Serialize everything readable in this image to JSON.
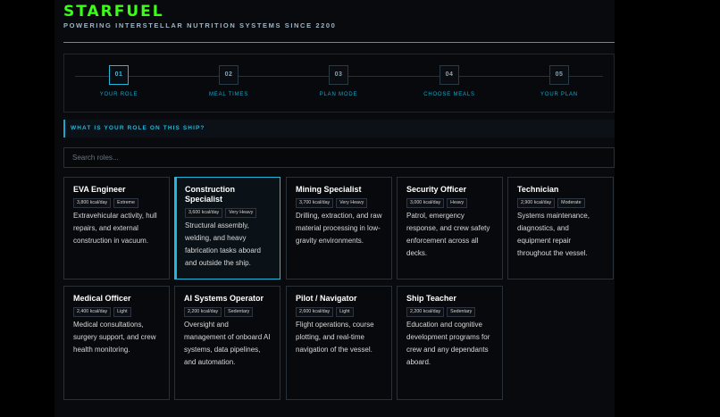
{
  "header": {
    "brand": "STARFUEL",
    "tagline": "POWERING INTERSTELLAR NUTRITION SYSTEMS SINCE 2200"
  },
  "steps": [
    {
      "num": "01",
      "label": "YOUR ROLE",
      "active": true
    },
    {
      "num": "02",
      "label": "MEAL TIMES",
      "active": false
    },
    {
      "num": "03",
      "label": "PLAN MODE",
      "active": false
    },
    {
      "num": "04",
      "label": "CHOOSE MEALS",
      "active": false
    },
    {
      "num": "05",
      "label": "YOUR PLAN",
      "active": false
    }
  ],
  "question": "WHAT IS YOUR ROLE ON THIS SHIP?",
  "search": {
    "placeholder": "Search roles...",
    "value": ""
  },
  "roles": [
    {
      "title": "EVA Engineer",
      "kcal": "3,800 kcal/day",
      "intensity": "Extreme",
      "description": "Extravehicular activity, hull repairs, and external construction in vacuum.",
      "selected": false
    },
    {
      "title": "Construction Specialist",
      "kcal": "3,600 kcal/day",
      "intensity": "Very Heavy",
      "description": "Structural assembly, welding, and heavy fabrication tasks aboard and outside the ship.",
      "selected": true
    },
    {
      "title": "Mining Specialist",
      "kcal": "3,700 kcal/day",
      "intensity": "Very Heavy",
      "description": "Drilling, extraction, and raw material processing in low-gravity environments.",
      "selected": false
    },
    {
      "title": "Security Officer",
      "kcal": "3,000 kcal/day",
      "intensity": "Heavy",
      "description": "Patrol, emergency response, and crew safety enforcement across all decks.",
      "selected": false
    },
    {
      "title": "Technician",
      "kcal": "2,900 kcal/day",
      "intensity": "Moderate",
      "description": "Systems maintenance, diagnostics, and equipment repair throughout the vessel.",
      "selected": false
    },
    {
      "title": "Medical Officer",
      "kcal": "2,400 kcal/day",
      "intensity": "Light",
      "description": "Medical consultations, surgery support, and crew health monitoring.",
      "selected": false
    },
    {
      "title": "AI Systems Operator",
      "kcal": "2,200 kcal/day",
      "intensity": "Sedentary",
      "description": "Oversight and management of onboard AI systems, data pipelines, and automation.",
      "selected": false
    },
    {
      "title": "Pilot / Navigator",
      "kcal": "2,600 kcal/day",
      "intensity": "Light",
      "description": "Flight operations, course plotting, and real-time navigation of the vessel.",
      "selected": false
    },
    {
      "title": "Ship Teacher",
      "kcal": "2,200 kcal/day",
      "intensity": "Sedentary",
      "description": "Education and cognitive development programs for crew and any dependants aboard.",
      "selected": false
    }
  ],
  "colors": {
    "brand": "#39ff14",
    "accent": "#21b8dc",
    "background": "#000000"
  }
}
